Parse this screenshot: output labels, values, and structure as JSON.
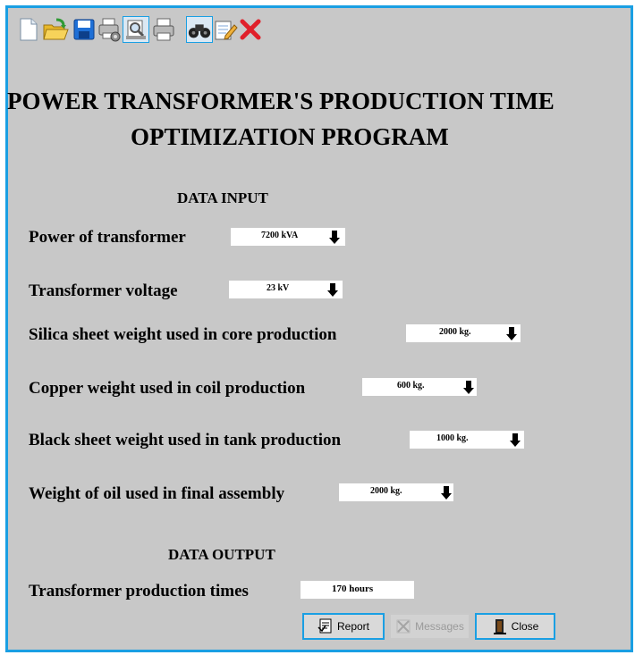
{
  "toolbar": {
    "icons": [
      "new-file-icon",
      "open-folder-icon",
      "save-icon",
      "print-setup-icon",
      "print-preview-icon",
      "print-icon",
      "find-binoculars-icon",
      "edit-notepad-icon",
      "close-x-icon"
    ]
  },
  "title": {
    "line1": "POWER TRANSFORMER'S PRODUCTION TIME",
    "line2": "OPTIMIZATION PROGRAM"
  },
  "input": {
    "heading": "DATA INPUT",
    "fields": [
      {
        "label": "Power of transformer",
        "value": "7200 kVA"
      },
      {
        "label": "Transformer voltage",
        "value": "23 kV"
      },
      {
        "label": "Silica sheet weight used in core production",
        "value": "2000 kg."
      },
      {
        "label": "Copper weight used in coil production",
        "value": "600 kg."
      },
      {
        "label": "Black sheet weight used in tank production",
        "value": "1000 kg."
      },
      {
        "label": "Weight of oil used in final assembly",
        "value": "2000 kg."
      }
    ]
  },
  "output": {
    "heading": "DATA OUTPUT",
    "label": "Transformer production times",
    "value": "170 hours"
  },
  "buttons": {
    "report": "Report",
    "messages": "Messages",
    "close": "Close"
  },
  "colors": {
    "background": "#c8c8c8",
    "frame": "#1a9fe3"
  }
}
